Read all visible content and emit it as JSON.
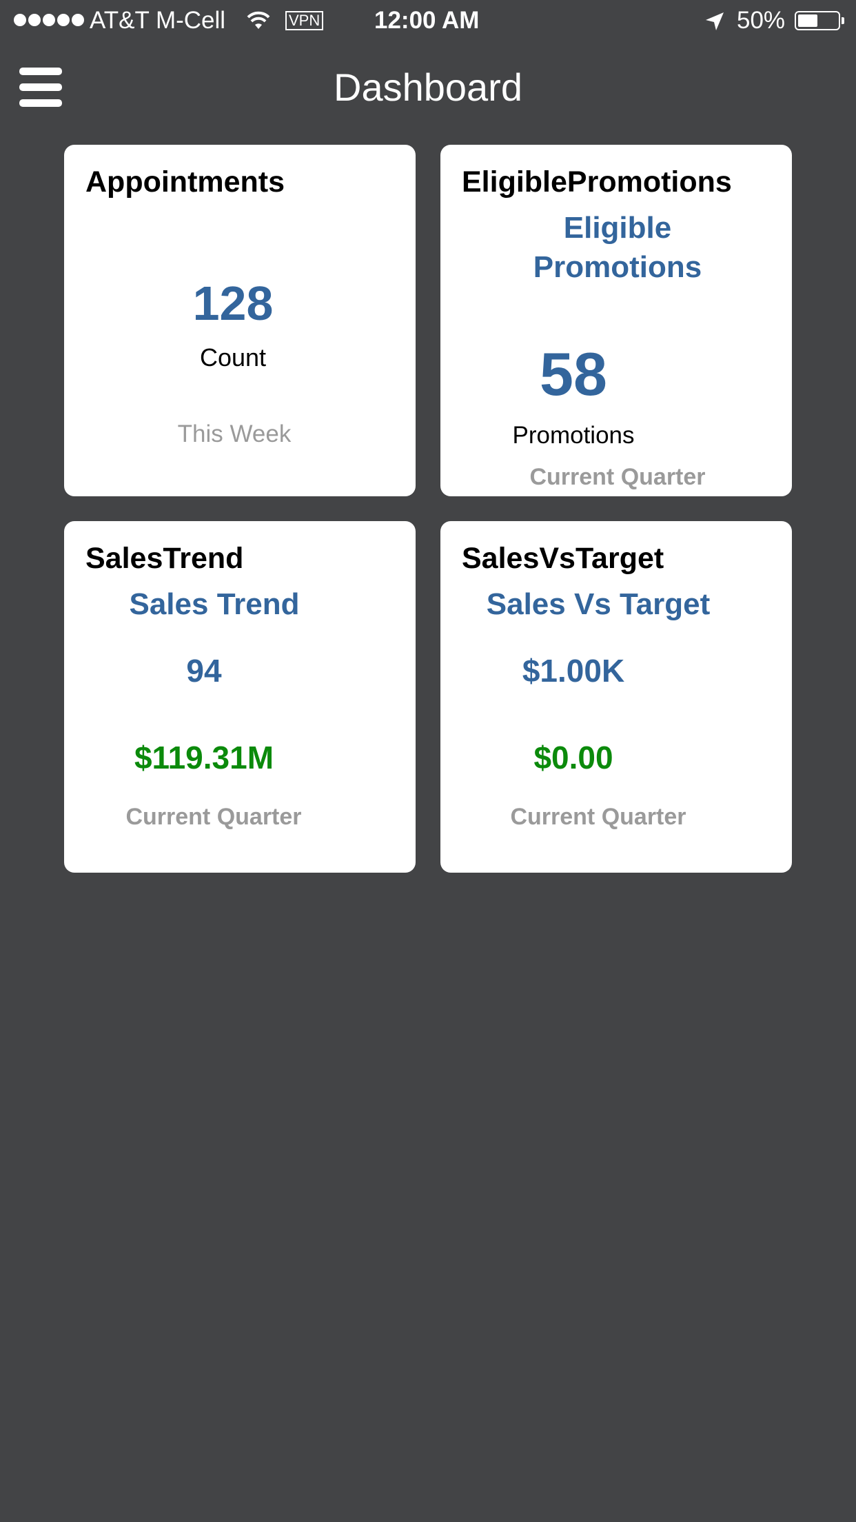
{
  "status_bar": {
    "carrier": "AT&T M-Cell",
    "vpn": "VPN",
    "time": "12:00 AM",
    "battery": "50%",
    "battery_level": 0.5
  },
  "header": {
    "title": "Dashboard",
    "menu_icon": "hamburger-menu-icon"
  },
  "cards": [
    {
      "title": "Appointments",
      "value": "128",
      "value_label": "Count",
      "period": "This Week"
    },
    {
      "title": "EligiblePromotions",
      "subtitle_line1": "Eligible",
      "subtitle_line2": "Promotions",
      "value": "58",
      "value_label": "Promotions",
      "period": "Current Quarter"
    },
    {
      "title": "SalesTrend",
      "subtitle": "Sales Trend",
      "primary": "94",
      "secondary": "$119.31M",
      "period": "Current Quarter"
    },
    {
      "title": "SalesVsTarget",
      "subtitle": "Sales Vs Target",
      "primary": "$1.00K",
      "secondary": "$0.00",
      "period": "Current Quarter"
    }
  ],
  "colors": {
    "background": "#434446",
    "accent_blue": "#33659c",
    "accent_green": "#0b8a0b",
    "muted_gray": "#9a9a9a"
  }
}
